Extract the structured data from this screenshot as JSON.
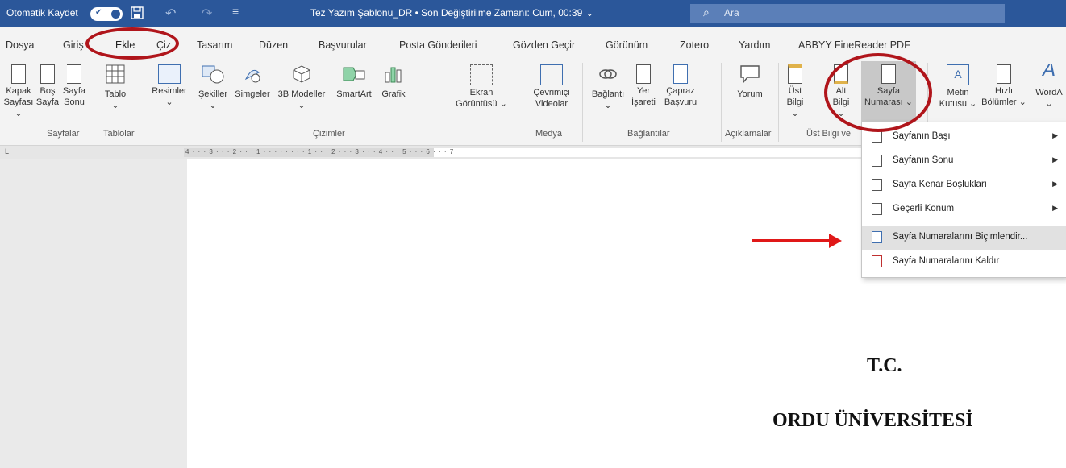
{
  "titlebar": {
    "autosave_label": "Otomatik Kaydet",
    "toggle_label": "✔",
    "doc_title": "Tez Yazım Şablonu_DR • Son Değiştirilme Zamanı: Cum, 00:39",
    "title_chevron": "⌄",
    "search_placeholder": "Ara",
    "undo": "↶",
    "redo": "↷",
    "customize": "≡",
    "search_icon": "⌕"
  },
  "tabs": [
    "Dosya",
    "Giriş",
    "Ekle",
    "Çiz",
    "Tasarım",
    "Düzen",
    "Başvurular",
    "Posta Gönderileri",
    "Gözden Geçir",
    "Görünüm",
    "Zotero",
    "Yardım",
    "ABBYY FineReader PDF"
  ],
  "ribbon": {
    "pages": {
      "cover": [
        "Kapak",
        "Sayfası ⌄"
      ],
      "blank": [
        "Boş",
        "Sayfa"
      ],
      "break": [
        "Sayfa",
        "Sonu"
      ],
      "group": "Sayfalar"
    },
    "tables": {
      "table": [
        "Tablo",
        "⌄"
      ],
      "group": "Tablolar"
    },
    "illustrations": {
      "pictures": [
        "Resimler",
        "⌄"
      ],
      "shapes": [
        "Şekiller",
        "⌄"
      ],
      "icons": [
        "Simgeler",
        ""
      ],
      "models": [
        "3B Modeller",
        "⌄"
      ],
      "smartart": [
        "SmartArt",
        ""
      ],
      "chart": [
        "Grafik",
        ""
      ],
      "screenshot": [
        "Ekran",
        "Görüntüsü ⌄"
      ],
      "group": "Çizimler"
    },
    "media": {
      "video": [
        "Çevrimiçi",
        "Videolar"
      ],
      "group": "Medya"
    },
    "links": {
      "link": [
        "Bağlantı",
        "⌄"
      ],
      "bookmark": [
        "Yer",
        "İşareti"
      ],
      "crossref": [
        "Çapraz",
        "Başvuru"
      ],
      "group": "Bağlantılar"
    },
    "comments": {
      "comment": [
        "Yorum",
        ""
      ],
      "group": "Açıklamalar"
    },
    "headerfooter": {
      "header": [
        "Üst",
        "Bilgi ⌄"
      ],
      "footer": [
        "Alt",
        "Bilgi ⌄"
      ],
      "pagenum": [
        "Sayfa",
        "Numarası ⌄"
      ],
      "group": "Üst Bilgi ve"
    },
    "text": {
      "textbox": [
        "Metin",
        "Kutusu ⌄"
      ],
      "quickparts": [
        "Hızlı",
        "Bölümler ⌄"
      ],
      "wordart": [
        "WordA",
        "⌄"
      ]
    }
  },
  "ruler": {
    "marks": "4 · · · 3 · · · 2 · · · 1 · · · · · · · · 1 · · · 2 · · · 3 · · · 4 · · · 5 · · · 6 · · · 7"
  },
  "document": {
    "line1": "T.C.",
    "line2": "ORDU ÜNİVERSİTESİ"
  },
  "menu": {
    "items": [
      {
        "label": "Sayfanın Başı",
        "submenu": "▶"
      },
      {
        "label": "Sayfanın Sonu",
        "submenu": "▶"
      },
      {
        "label": "Sayfa Kenar Boşlukları",
        "submenu": "▶"
      },
      {
        "label": "Geçerli Konum",
        "submenu": "▶"
      },
      {
        "label": "Sayfa Numaralarını Biçimlendir...",
        "submenu": ""
      },
      {
        "label": "Sayfa Numaralarını Kaldır",
        "submenu": ""
      }
    ]
  },
  "colors": {
    "titlebar": "#2b579a",
    "annotation": "#b0151b",
    "arrow": "#e01818"
  }
}
